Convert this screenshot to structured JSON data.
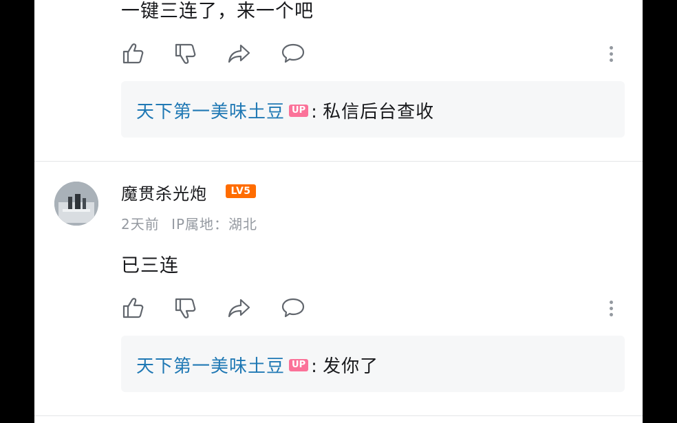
{
  "comment1": {
    "text": "一键三连了，来一个吧",
    "reply": {
      "author": "天下第一美味土豆",
      "badge": "UP",
      "separator": ":",
      "content": "私信后台查收"
    }
  },
  "comment2": {
    "username": "魔贯杀光炮",
    "level_badge": "LV5",
    "time": "2天前",
    "ip_location": "IP属地：湖北",
    "text": "已三连",
    "reply": {
      "author": "天下第一美味土豆",
      "badge": "UP",
      "separator": ":",
      "content": "发你了"
    }
  },
  "icons": [
    "thumb-up-icon",
    "thumb-down-icon",
    "share-icon",
    "reply-bubble-icon",
    "more-vertical-icon"
  ],
  "colors": {
    "up_name": "#1f78b4",
    "up_badge": "#fb7299",
    "level_badge": "#ff6c00",
    "meta_text": "#9499a0",
    "reply_bg": "#f6f7f8"
  }
}
